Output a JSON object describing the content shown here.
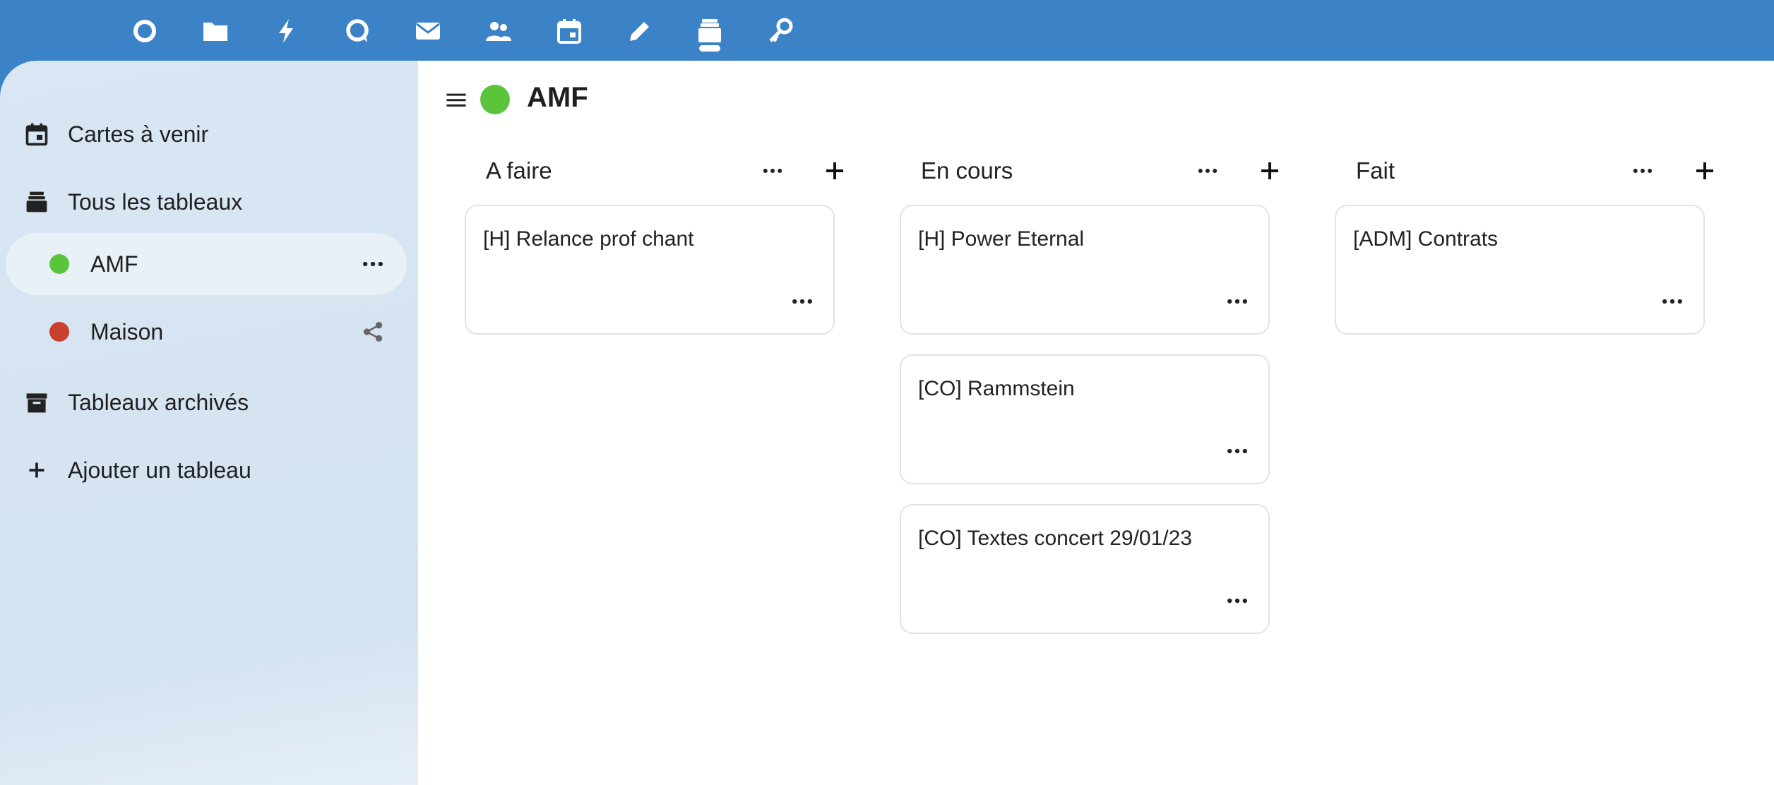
{
  "topbar": {
    "apps": [
      {
        "name": "dashboard-icon"
      },
      {
        "name": "files-icon"
      },
      {
        "name": "activity-icon"
      },
      {
        "name": "talk-icon"
      },
      {
        "name": "mail-icon"
      },
      {
        "name": "contacts-icon"
      },
      {
        "name": "calendar-icon"
      },
      {
        "name": "notes-icon"
      },
      {
        "name": "deck-icon"
      },
      {
        "name": "passwords-icon"
      }
    ],
    "active_app": "deck-icon",
    "color": "#3b82c6"
  },
  "sidebar": {
    "upcoming_label": "Cartes à venir",
    "all_boards_label": "Tous les tableaux",
    "boards": [
      {
        "label": "AMF",
        "color": "#5ac43b",
        "active": true
      },
      {
        "label": "Maison",
        "color": "#c9412d",
        "active": false
      }
    ],
    "archived_label": "Tableaux archivés",
    "add_board_label": "Ajouter un tableau"
  },
  "board": {
    "title": "AMF",
    "color": "#5ac43b",
    "stacks": [
      {
        "title": "A faire",
        "cards": [
          "[H] Relance prof chant"
        ]
      },
      {
        "title": "En cours",
        "cards": [
          "[H] Power Eternal",
          "[CO] Rammstein",
          "[CO] Textes concert 29/01/23"
        ]
      },
      {
        "title": "Fait",
        "cards": [
          "[ADM] Contrats"
        ]
      }
    ]
  }
}
